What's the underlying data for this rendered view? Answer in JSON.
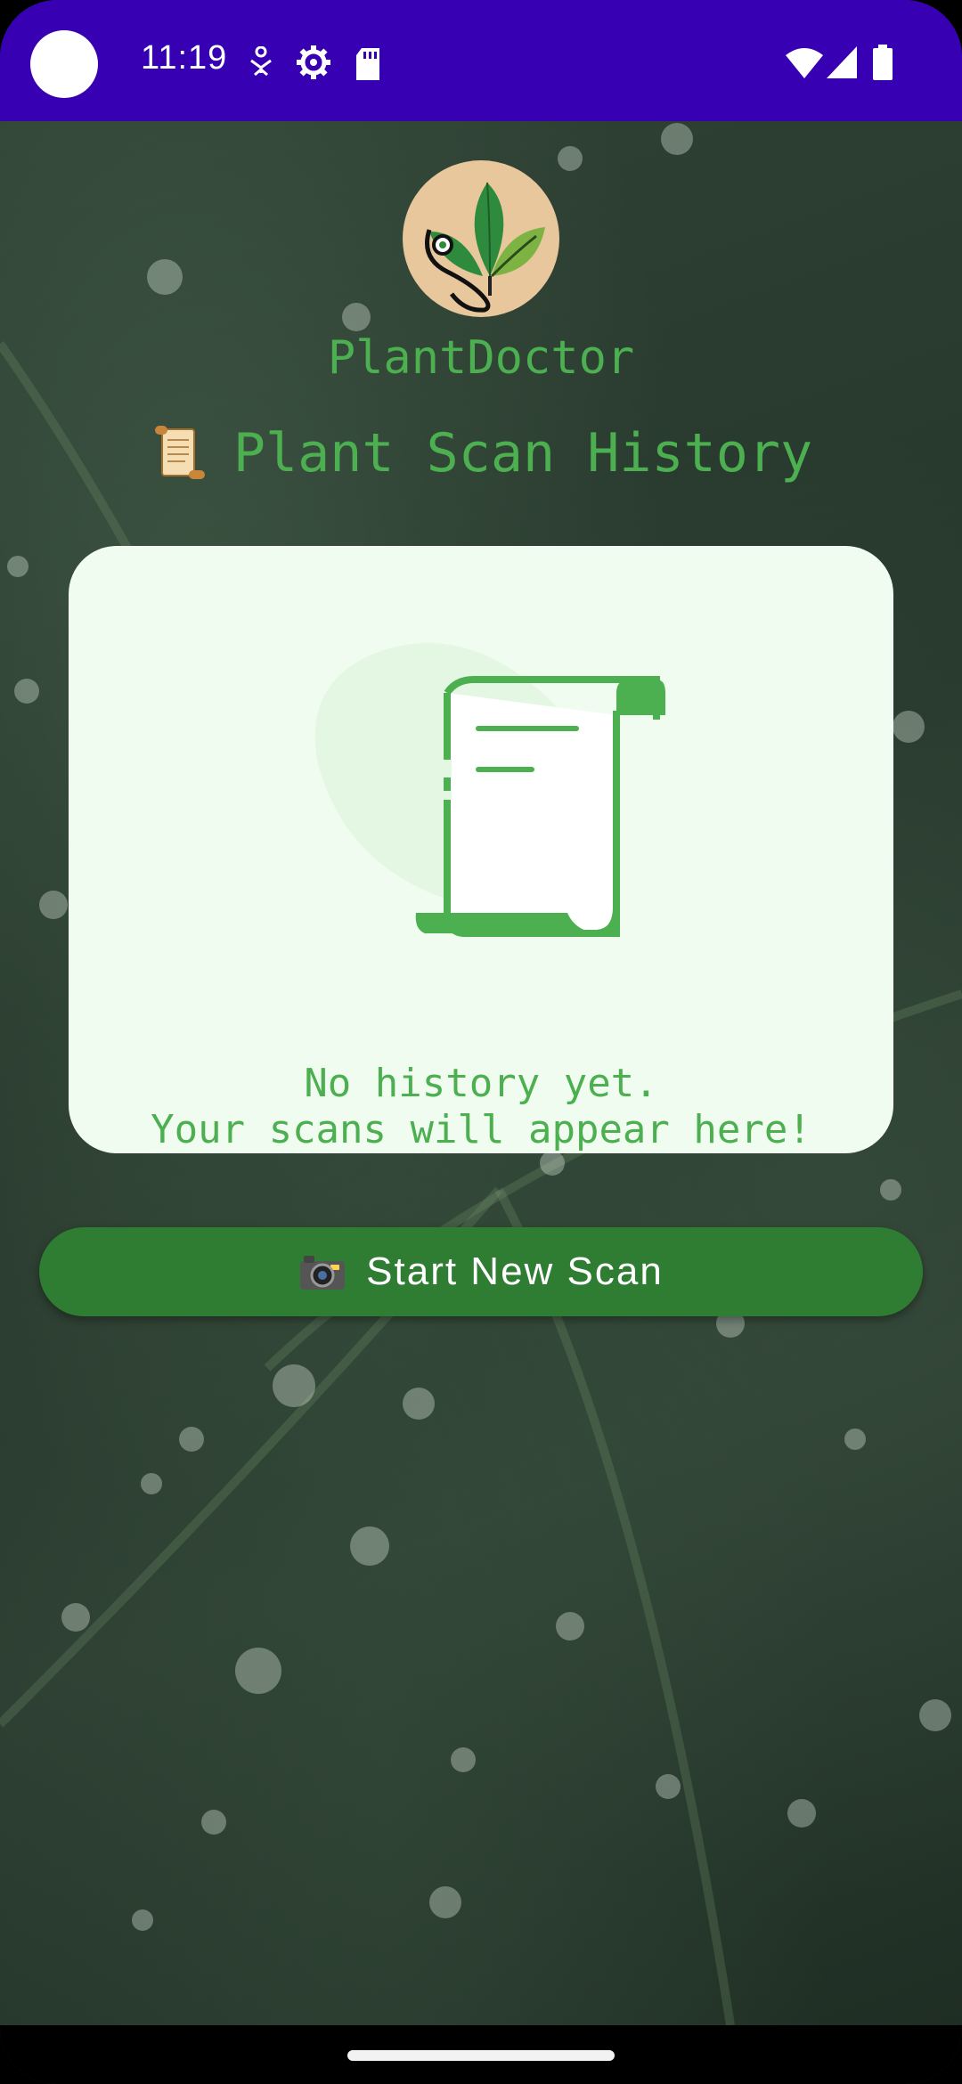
{
  "status_bar": {
    "time": "11:19",
    "icons": [
      "accessibility-icon",
      "settings-gear-icon",
      "sd-card-icon",
      "wifi-icon",
      "cell-signal-icon",
      "battery-icon"
    ]
  },
  "header": {
    "app_name": "PlantDoctor",
    "page_title": "Plant Scan History",
    "page_title_icon": "scroll-icon"
  },
  "empty_state": {
    "illustration": "document-scroll-icon",
    "line1": "No history yet.",
    "line2": "Your scans will appear here!"
  },
  "actions": {
    "start_scan_label": "Start New Scan",
    "start_scan_icon": "camera-icon"
  },
  "colors": {
    "status_bar": "#3700b3",
    "accent_green": "#4caf50",
    "button_green": "#2e7d32",
    "card_bg": "#f1fcf0"
  }
}
